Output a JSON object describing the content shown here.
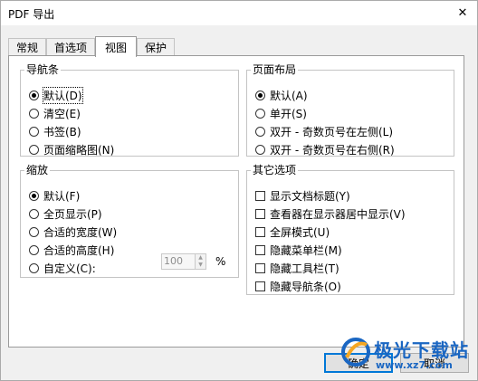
{
  "window": {
    "title": "PDF 导出",
    "close_symbol": "✕"
  },
  "tabs": [
    "常规",
    "首选项",
    "视图",
    "保护"
  ],
  "active_tab": 2,
  "groups": {
    "nav": {
      "title": "导航条",
      "options": [
        "默认(D)",
        "清空(E)",
        "书签(B)",
        "页面缩略图(N)"
      ],
      "selected": 0
    },
    "layout": {
      "title": "页面布局",
      "options": [
        "默认(A)",
        "单开(S)",
        "双开 - 奇数页号在左侧(L)",
        "双开 - 奇数页号在右侧(R)"
      ],
      "selected": 0
    },
    "zoom": {
      "title": "缩放",
      "options": [
        "默认(F)",
        "全页显示(P)",
        "合适的宽度(W)",
        "合适的高度(H)",
        "自定义(C):"
      ],
      "selected": 0,
      "custom_value": "100",
      "unit": "%"
    },
    "other": {
      "title": "其它选项",
      "checkboxes": [
        "显示文档标题(Y)",
        "查看器在显示器居中显示(V)",
        "全屏模式(U)",
        "隐藏菜单栏(M)",
        "隐藏工具栏(T)",
        "隐藏导航条(O)"
      ],
      "checked": [
        false,
        false,
        false,
        false,
        false,
        false
      ]
    }
  },
  "buttons": {
    "ok": "确定",
    "cancel": "取消"
  },
  "watermark": {
    "text": "极光下载站",
    "url": "www.xz7.com"
  }
}
